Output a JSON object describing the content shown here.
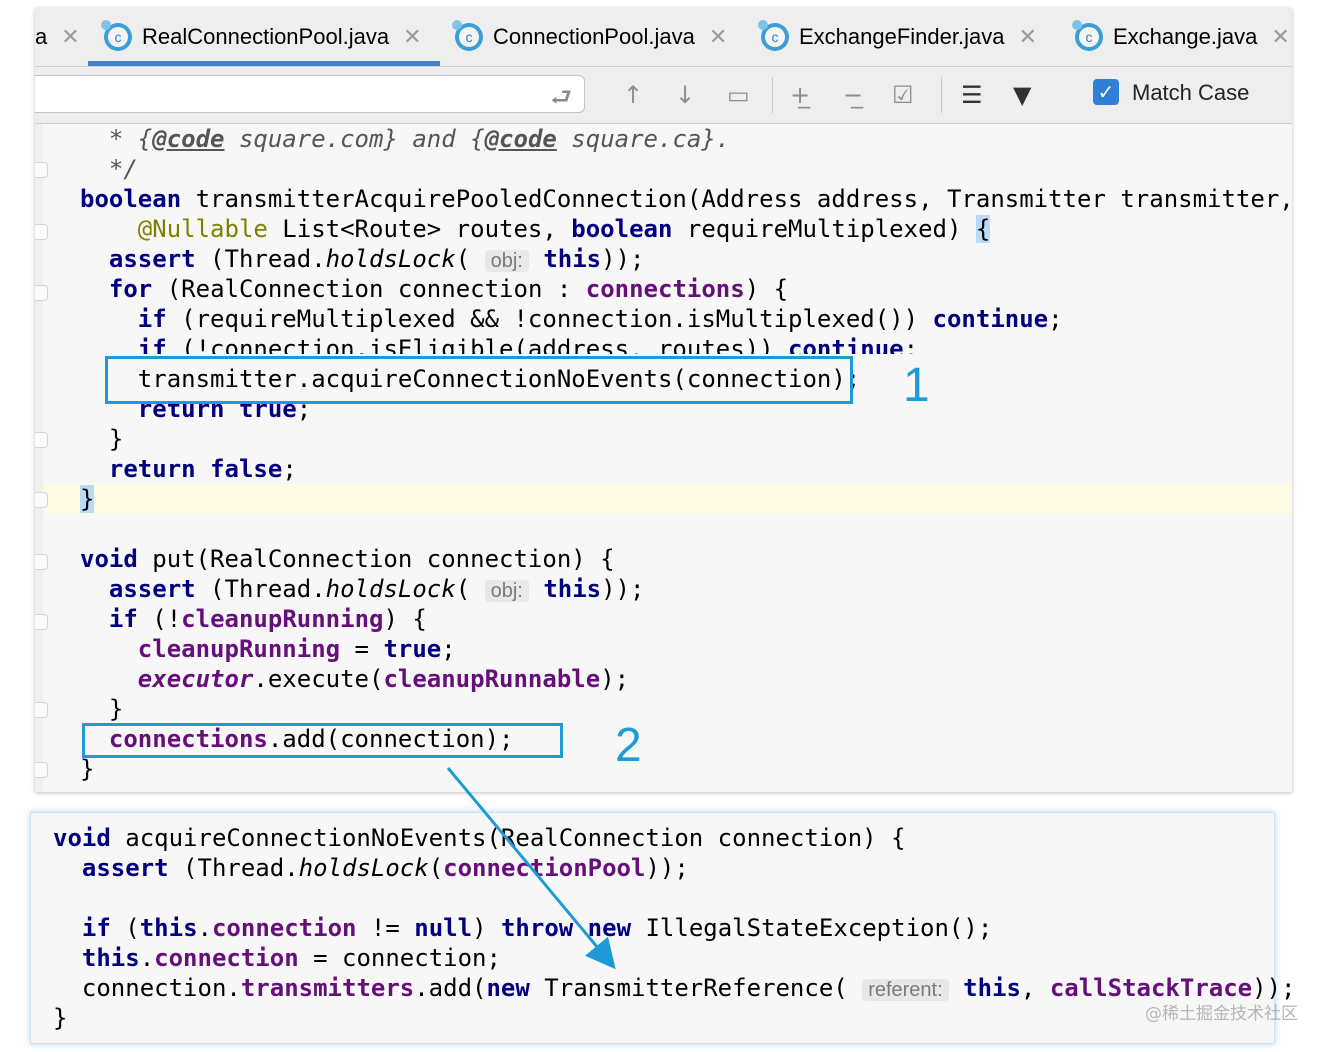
{
  "tabs": [
    {
      "label": "a",
      "icon": "class-icon"
    },
    {
      "label": "RealConnectionPool.java",
      "icon": "class-icon",
      "active": true
    },
    {
      "label": "ConnectionPool.java",
      "icon": "class-icon"
    },
    {
      "label": "ExchangeFinder.java",
      "icon": "class-icon"
    },
    {
      "label": "Exchange.java",
      "icon": "class-icon"
    }
  ],
  "find": {
    "search_value": "",
    "match_case_label": "Match Case",
    "match_case_checked": true
  },
  "editor": {
    "lines": [
      "  * {@code square.com} and {@code square.ca}.",
      "  */",
      "boolean transmitterAcquirePooledConnection(Address address, Transmitter transmitter,",
      "    @Nullable List<Route> routes, boolean requireMultiplexed) {",
      "  assert (Thread.holdsLock( obj: this));",
      "  for (RealConnection connection : connections) {",
      "    if (requireMultiplexed && !connection.isMultiplexed()) continue;",
      "    if (!connection.isEligible(address, routes)) continue;",
      "    transmitter.acquireConnectionNoEvents(connection);",
      "    return true;",
      "  }",
      "  return false;",
      "}",
      "",
      "void put(RealConnection connection) {",
      "  assert (Thread.holdsLock( obj: this));",
      "  if (!cleanupRunning) {",
      "    cleanupRunning = true;",
      "    executor.execute(cleanupRunnable);",
      "  }",
      "  connections.add(connection);",
      "}"
    ]
  },
  "annotations": {
    "box1_number": "1",
    "box2_number": "2"
  },
  "popup": {
    "lines": [
      "void acquireConnectionNoEvents(RealConnection connection) {",
      "  assert (Thread.holdsLock(connectionPool));",
      "",
      "  if (this.connection != null) throw new IllegalStateException();",
      "  this.connection = connection;",
      "  connection.transmitters.add(new TransmitterReference( referent: this, callStackTrace));",
      "}"
    ]
  },
  "watermark": "@稀土掘金技术社区",
  "colors": {
    "accent": "#1e9bd7",
    "keyword": "#000080",
    "field": "#660e7a",
    "checkbox": "#2f7fd4"
  }
}
